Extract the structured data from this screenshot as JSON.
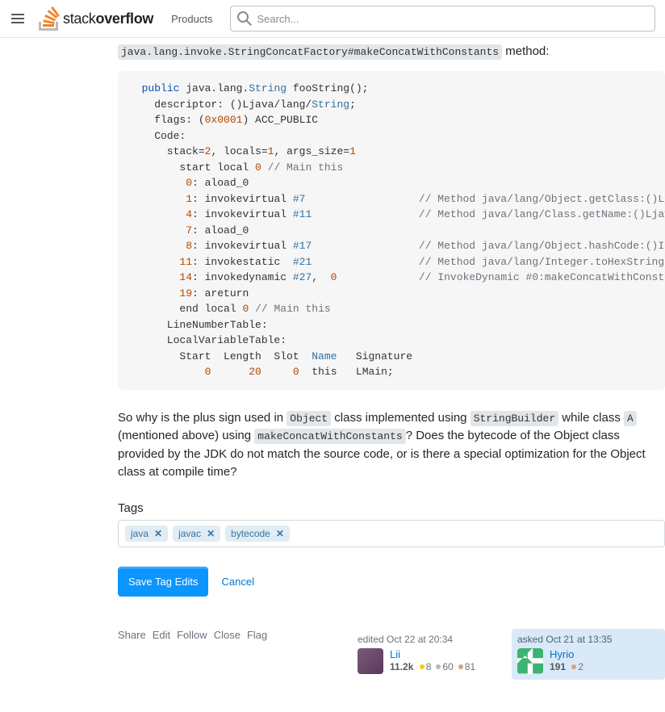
{
  "header": {
    "logo_text_1": "stack",
    "logo_text_2": "overflow",
    "products": "Products",
    "search_placeholder": "Search..."
  },
  "method_code": "java.lang.invoke.StringConcatFactory#makeConcatWithConstants",
  "method_after": " method:",
  "codeblock_html": "  <span class='kw-blue'>public</span> java.lang.<span class='type'>String</span> fooString();\n    descriptor: ()Ljava/lang/<span class='type'>String</span>;\n    flags: (<span class='num'>0x0001</span>) ACC_PUBLIC\n    Code:\n      stack=<span class='num'>2</span>, locals=<span class='num'>1</span>, args_size=<span class='num'>1</span>\n        start local <span class='num'>0</span> <span class='cmt'>// Main this</span>\n         <span class='num'>0</span>: aload_0\n         <span class='num'>1</span>: invokevirtual <span class='ref'>#7</span>                  <span class='cmt'>// Method java/lang/Object.getClass:()Ljava/lang/Class;</span>\n         <span class='num'>4</span>: invokevirtual <span class='ref'>#11</span>                 <span class='cmt'>// Method java/lang/Class.getName:()Ljava/lang/String;</span>\n         <span class='num'>7</span>: aload_0\n         <span class='num'>8</span>: invokevirtual <span class='ref'>#17</span>                 <span class='cmt'>// Method java/lang/Object.hashCode:()I</span>\n        <span class='num'>11</span>: invokestatic  <span class='ref'>#21</span>                 <span class='cmt'>// Method java/lang/Integer.toHexString:(I)Ljava/lang/String;</span>\n        <span class='num'>14</span>: invokedynamic <span class='ref'>#27</span>,  <span class='num'>0</span>             <span class='cmt'>// InvokeDynamic #0:makeConcatWithConstants:(Ljava/lang/String;Ljava/lang/String;)Ljava/lang/String;</span>\n        <span class='num'>19</span>: areturn\n        end local <span class='num'>0</span> <span class='cmt'>// Main this</span>\n      LineNumberTable:\n      LocalVariableTable:\n        Start  Length  Slot  <span class='type'>Name</span>   Signature\n            <span class='num'>0</span>      <span class='num'>20</span>     <span class='num'>0</span>  this   LMain;",
  "para": {
    "p1a": "So why is the plus sign used in ",
    "p1_code1": "Object",
    "p1b": " class implemented using ",
    "p1_code2": "StringBuilder",
    "p1c": " while class ",
    "p1_code3": "A",
    "p1d": " (mentioned above) using ",
    "p1_code4": "makeConcatWithConstants",
    "p1e": "? Does the bytecode of the Object class provided by the JDK do not match the source code, or is there a special optimization for the Object class at compile time?"
  },
  "tags_heading": "Tags",
  "tags": {
    "t1": "java",
    "t2": "javac",
    "t3": "bytecode"
  },
  "buttons": {
    "save": "Save Tag Edits",
    "cancel": "Cancel"
  },
  "actions": {
    "share": "Share",
    "edit": "Edit",
    "follow": "Follow",
    "close": "Close",
    "flag": "Flag"
  },
  "edited": {
    "label": "edited Oct 22 at 20:34",
    "user": "Lii",
    "rep": "11.2k",
    "gold": "8",
    "silver": "60",
    "bronze": "81"
  },
  "asked": {
    "label": "asked Oct 21 at 13:35",
    "user": "Hyrio",
    "rep": "191",
    "bronze": "2"
  }
}
